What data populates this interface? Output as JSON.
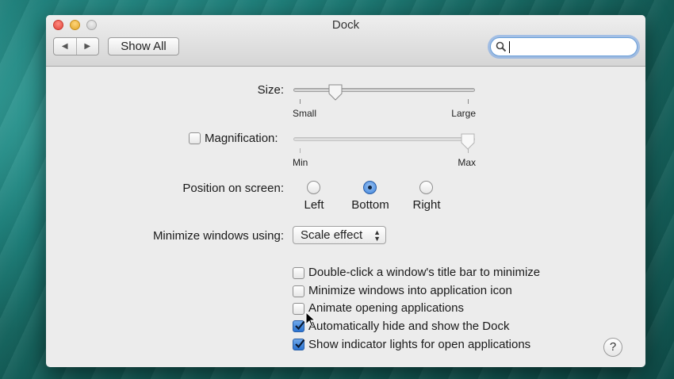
{
  "window": {
    "title": "Dock"
  },
  "toolbar": {
    "back_icon": "◀",
    "forward_icon": "▶",
    "show_all_label": "Show All",
    "search_value": ""
  },
  "size": {
    "label": "Size:",
    "min_label": "Small",
    "max_label": "Large",
    "value": 0.23
  },
  "magnification": {
    "label": "Magnification:",
    "checked": false,
    "min_label": "Min",
    "max_label": "Max",
    "value": 1.0
  },
  "position": {
    "label": "Position on screen:",
    "options": [
      "Left",
      "Bottom",
      "Right"
    ],
    "selected": "Bottom"
  },
  "minimize": {
    "label": "Minimize windows using:",
    "value": "Scale effect"
  },
  "options": [
    {
      "label": "Double-click a window's title bar to minimize",
      "checked": false
    },
    {
      "label": "Minimize windows into application icon",
      "checked": false
    },
    {
      "label": "Animate opening applications",
      "checked": false
    },
    {
      "label": "Automatically hide and show the Dock",
      "checked": true
    },
    {
      "label": "Show indicator lights for open applications",
      "checked": true
    }
  ],
  "help": {
    "label": "?"
  },
  "colors": {
    "accent": "#2a73d2",
    "window_bg": "#ececec"
  }
}
